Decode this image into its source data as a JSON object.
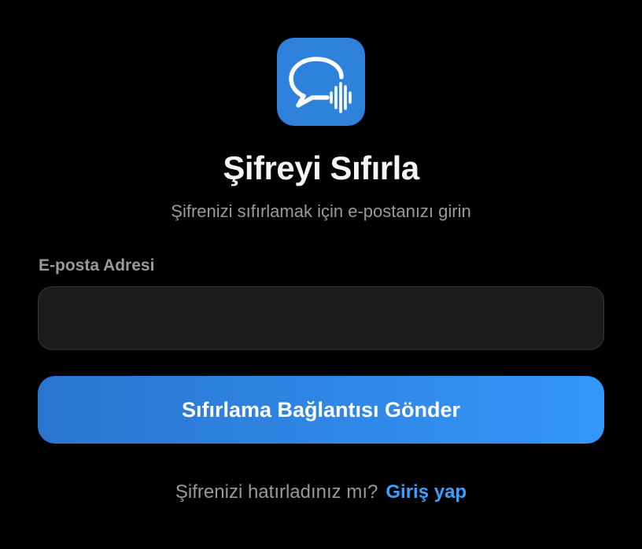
{
  "app": {
    "icon_name": "speech-bubble-waveform-icon",
    "icon_color": "#2f82dc"
  },
  "header": {
    "title": "Şifreyi Sıfırla",
    "subtitle": "Şifrenizi sıfırlamak için e-postanızı girin"
  },
  "form": {
    "email_label": "E-posta Adresi",
    "email_value": "",
    "email_placeholder": "",
    "submit_label": "Sıfırlama Bağlantısı Gönder"
  },
  "footer": {
    "prompt": "Şifrenizi hatırladınız mı?",
    "login_link": "Giriş yap"
  },
  "colors": {
    "background": "#000000",
    "accent": "#3497fa",
    "link": "#3aa0ff",
    "muted_text": "#9a9a9a",
    "input_bg": "#1c1c1e"
  }
}
